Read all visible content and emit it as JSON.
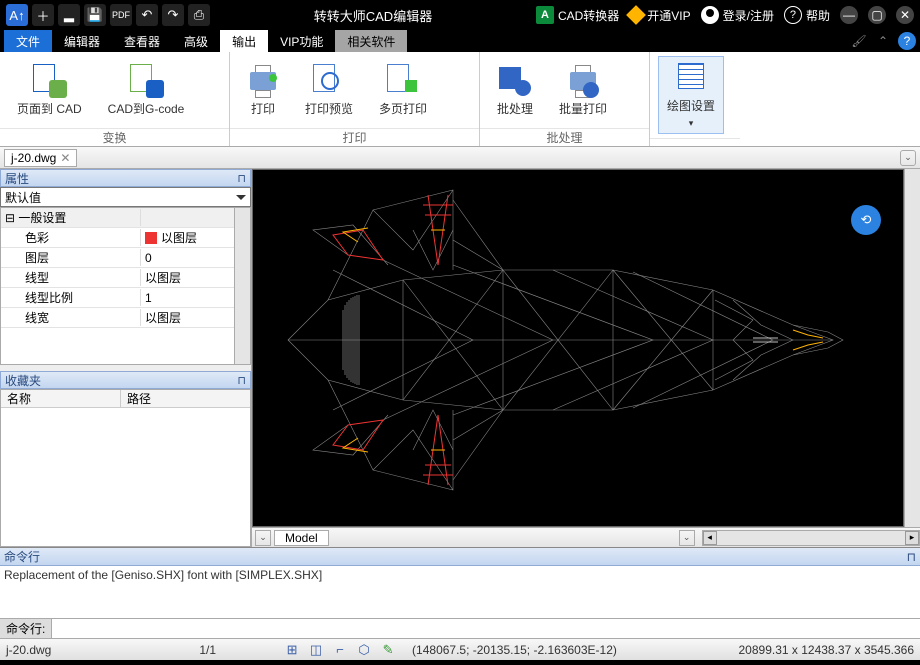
{
  "title": "转转大师CAD编辑器",
  "tb_right": {
    "conv": "CAD转换器",
    "vip": "开通VIP",
    "login": "登录/注册",
    "help": "帮助"
  },
  "menu": {
    "file": "文件",
    "editor": "编辑器",
    "viewer": "查看器",
    "adv": "高级",
    "output": "输出",
    "vipfn": "VIP功能",
    "related": "相关软件"
  },
  "ribbon": {
    "g1": "变换",
    "g2": "打印",
    "g3": "批处理",
    "b1": "页面到 CAD",
    "b2": "CAD到G-code",
    "b3": "打印",
    "b4": "打印预览",
    "b5": "多页打印",
    "b6": "批处理",
    "b7": "批量打印",
    "b8": "绘图设置"
  },
  "filetab": "j-20.dwg",
  "panels": {
    "props": "属性",
    "fav": "收藏夹",
    "cmd": "命令行"
  },
  "combo": "默认值",
  "props": {
    "grp": "一般设置",
    "rows": [
      [
        "色彩",
        "以图层"
      ],
      [
        "图层",
        "0"
      ],
      [
        "线型",
        "以图层"
      ],
      [
        "线型比例",
        "1"
      ],
      [
        "线宽",
        "以图层"
      ]
    ]
  },
  "favcols": {
    "c1": "名称",
    "c2": "路径"
  },
  "modeltab": "Model",
  "cmdtext": "Replacement of the [Geniso.SHX] font with [SIMPLEX.SHX]",
  "cmdlabel": "命令行:",
  "status": {
    "file": "j-20.dwg",
    "page": "1/1",
    "coord": "(148067.5; -20135.15; -2.163603E-12)",
    "ext": "20899.31 x 12438.37 x 3545.366"
  }
}
